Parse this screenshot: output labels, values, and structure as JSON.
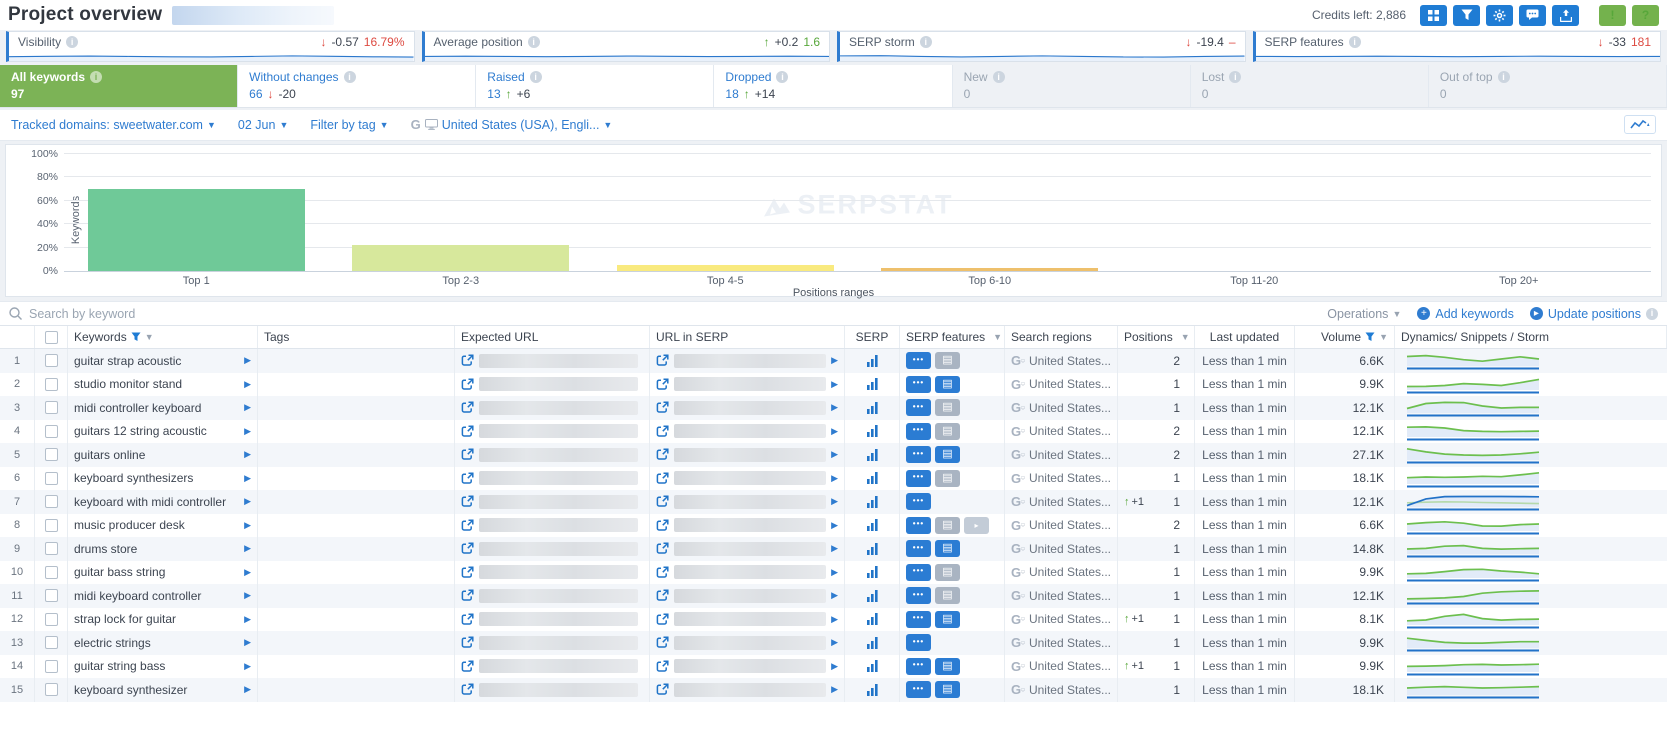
{
  "topbar": {
    "title": "Project overview",
    "credits": "Credits left: 2,886"
  },
  "accent_colors": {
    "blue": "#2f7cd0",
    "green_tab": "#7cb356",
    "red": "#dd4a41",
    "green": "#57a73a"
  },
  "metric_cards": [
    {
      "label": "Visibility",
      "arrow": "↓",
      "arrow_color": "red",
      "delta": "-0.57",
      "value": "16.79%",
      "value_color": "red",
      "wave": [
        0.45,
        0.52,
        0.55,
        0.5,
        0.44,
        0.42,
        0.5,
        0.58,
        0.52,
        0.44,
        0.4
      ]
    },
    {
      "label": "Average position",
      "arrow": "↑",
      "arrow_color": "green",
      "delta": "+0.2",
      "value": "1.6",
      "value_color": "green",
      "wave": [
        0.5,
        0.53,
        0.5,
        0.46,
        0.5,
        0.55,
        0.52,
        0.47,
        0.5,
        0.53,
        0.5
      ]
    },
    {
      "label": "SERP storm",
      "arrow": "↓",
      "arrow_color": "red",
      "delta": "-19.4",
      "value": "–",
      "value_color": "red",
      "wave": [
        0.58,
        0.62,
        0.5,
        0.42,
        0.5,
        0.58,
        0.5,
        0.42,
        0.4,
        0.5,
        0.55
      ]
    },
    {
      "label": "SERP features",
      "arrow": "↓",
      "arrow_color": "red",
      "delta": "-33",
      "value": "181",
      "value_color": "red",
      "wave": [
        0.5,
        0.47,
        0.5,
        0.54,
        0.5,
        0.46,
        0.5,
        0.54,
        0.5,
        0.47,
        0.5
      ]
    }
  ],
  "tabs": [
    {
      "label": "All keywords",
      "value": "97",
      "state": "active",
      "arrow": "",
      "delta": ""
    },
    {
      "label": "Without changes",
      "value": "66",
      "state": "normal",
      "arrow": "↓",
      "arrow_color": "red",
      "delta": "-20"
    },
    {
      "label": "Raised",
      "value": "13",
      "state": "normal",
      "arrow": "↑",
      "arrow_color": "green",
      "delta": "+6"
    },
    {
      "label": "Dropped",
      "value": "18",
      "state": "normal",
      "arrow": "↑",
      "arrow_color": "green",
      "delta": "+14"
    },
    {
      "label": "New",
      "value": "0",
      "state": "disabled",
      "arrow": "",
      "delta": ""
    },
    {
      "label": "Lost",
      "value": "0",
      "state": "disabled",
      "arrow": "",
      "delta": ""
    },
    {
      "label": "Out of top",
      "value": "0",
      "state": "disabled",
      "arrow": "",
      "delta": ""
    }
  ],
  "filter_bar": {
    "tracked_domains": "Tracked domains: sweetwater.com",
    "date": "02 Jun",
    "tag": "Filter by tag",
    "region": "United States (USA), Engli..."
  },
  "chart_data": {
    "type": "bar",
    "categories": [
      "Top 1",
      "Top 2-3",
      "Top 4-5",
      "Top 6-10",
      "Top 11-20",
      "Top 20+"
    ],
    "values": [
      70,
      22,
      5,
      3,
      0,
      0
    ],
    "unit": "%",
    "bar_colors": [
      "#6fc998",
      "#d7e89c",
      "#f9ea7f",
      "#eec06c",
      "#cfd6df",
      "#cfd6df"
    ],
    "title": "",
    "xlabel": "Positions ranges",
    "ylabel": "Keywords",
    "ylim": [
      0,
      100
    ],
    "yticks": [
      "0%",
      "20%",
      "40%",
      "60%",
      "80%",
      "100%"
    ],
    "grid": true,
    "legend": "none",
    "watermark": "SERPSTAT"
  },
  "actions": {
    "search_placeholder": "Search by keyword",
    "operations": "Operations",
    "add_keywords": "Add keywords",
    "update_positions": "Update positions"
  },
  "table": {
    "columns": [
      "#",
      "Keywords",
      "Tags",
      "Expected URL",
      "URL in SERP",
      "SERP",
      "SERP features",
      "Search regions",
      "Positions",
      "Last updated",
      "Volume",
      "Dynamics/ Snippets / Storm"
    ],
    "filtered_columns": [
      "Keywords",
      "SERP features",
      "Positions",
      "Volume"
    ],
    "region_text": "United States...",
    "updated_text": "Less than 1 min",
    "rows": [
      {
        "num": "1",
        "keyword": "guitar strap acoustic",
        "features": [
          "dots-blue",
          "snippet-grey"
        ],
        "pos_delta": "",
        "position": "2",
        "volume": "6.6K",
        "spark": {
          "variant": "green",
          "line": [
            0.68,
            0.74,
            0.62,
            0.45,
            0.34,
            0.5,
            0.66,
            0.5
          ]
        }
      },
      {
        "num": "2",
        "keyword": "studio monitor stand",
        "features": [
          "dots-blue",
          "snippet-blue"
        ],
        "pos_delta": "",
        "position": "1",
        "volume": "9.9K",
        "spark": {
          "variant": "green",
          "line": [
            0.25,
            0.26,
            0.32,
            0.46,
            0.4,
            0.32,
            0.52,
            0.76
          ]
        }
      },
      {
        "num": "3",
        "keyword": "midi controller keyboard",
        "features": [
          "dots-blue",
          "snippet-grey"
        ],
        "pos_delta": "",
        "position": "1",
        "volume": "12.1K",
        "spark": {
          "variant": "green",
          "line": [
            0.32,
            0.68,
            0.76,
            0.74,
            0.5,
            0.36,
            0.4,
            0.4
          ]
        }
      },
      {
        "num": "4",
        "keyword": "guitars 12 string acoustic",
        "features": [
          "dots-blue",
          "snippet-grey"
        ],
        "pos_delta": "",
        "position": "2",
        "volume": "12.1K",
        "spark": {
          "variant": "green",
          "line": [
            0.7,
            0.72,
            0.64,
            0.46,
            0.4,
            0.38,
            0.4,
            0.42
          ]
        }
      },
      {
        "num": "5",
        "keyword": "guitars online",
        "features": [
          "dots-blue",
          "snippet-blue"
        ],
        "pos_delta": "",
        "position": "2",
        "volume": "27.1K",
        "spark": {
          "variant": "green",
          "line": [
            0.8,
            0.58,
            0.42,
            0.36,
            0.33,
            0.36,
            0.44,
            0.56
          ]
        }
      },
      {
        "num": "6",
        "keyword": "keyboard synthesizers",
        "features": [
          "dots-blue",
          "snippet-grey"
        ],
        "pos_delta": "",
        "position": "1",
        "volume": "18.1K",
        "spark": {
          "variant": "green",
          "line": [
            0.45,
            0.5,
            0.48,
            0.5,
            0.55,
            0.52,
            0.65,
            0.8
          ]
        }
      },
      {
        "num": "7",
        "keyword": "keyboard with midi controller",
        "features": [
          "dots-blue"
        ],
        "pos_delta": "+1",
        "position": "1",
        "volume": "12.1K",
        "spark": {
          "variant": "blue",
          "line": [
            0.1,
            0.58,
            0.74,
            0.75,
            0.75,
            0.75,
            0.74,
            0.73
          ],
          "line2": [
            0.3,
            0.34,
            0.37,
            0.36,
            0.32,
            0.3,
            0.27,
            0.24
          ]
        }
      },
      {
        "num": "8",
        "keyword": "music producer desk",
        "features": [
          "dots-blue",
          "snippet-grey",
          "arrow-grey"
        ],
        "pos_delta": "",
        "position": "2",
        "volume": "6.6K",
        "spark": {
          "variant": "green",
          "line": [
            0.5,
            0.6,
            0.66,
            0.56,
            0.36,
            0.35,
            0.46,
            0.5
          ]
        }
      },
      {
        "num": "9",
        "keyword": "drums store",
        "features": [
          "dots-blue",
          "snippet-blue"
        ],
        "pos_delta": "",
        "position": "1",
        "volume": "14.8K",
        "spark": {
          "variant": "green",
          "line": [
            0.36,
            0.4,
            0.56,
            0.6,
            0.4,
            0.35,
            0.38,
            0.4
          ]
        }
      },
      {
        "num": "10",
        "keyword": "guitar bass string",
        "features": [
          "dots-blue",
          "snippet-grey"
        ],
        "pos_delta": "",
        "position": "1",
        "volume": "9.9K",
        "spark": {
          "variant": "green",
          "line": [
            0.3,
            0.33,
            0.46,
            0.6,
            0.62,
            0.5,
            0.42,
            0.3
          ]
        }
      },
      {
        "num": "11",
        "keyword": "midi keyboard controller",
        "features": [
          "dots-blue",
          "snippet-grey"
        ],
        "pos_delta": "",
        "position": "1",
        "volume": "12.1K",
        "spark": {
          "variant": "green",
          "line": [
            0.15,
            0.18,
            0.22,
            0.32,
            0.56,
            0.66,
            0.7,
            0.72
          ]
        }
      },
      {
        "num": "12",
        "keyword": "strap lock for guitar",
        "features": [
          "dots-blue",
          "snippet-blue"
        ],
        "pos_delta": "+1",
        "position": "1",
        "volume": "8.1K",
        "spark": {
          "variant": "green",
          "line": [
            0.3,
            0.36,
            0.62,
            0.76,
            0.46,
            0.35,
            0.4,
            0.42
          ]
        }
      },
      {
        "num": "13",
        "keyword": "electric strings",
        "features": [
          "dots-blue"
        ],
        "pos_delta": "",
        "position": "1",
        "volume": "9.9K",
        "spark": {
          "variant": "green",
          "line": [
            0.7,
            0.54,
            0.4,
            0.35,
            0.35,
            0.4,
            0.45,
            0.45
          ]
        }
      },
      {
        "num": "14",
        "keyword": "guitar string bass",
        "features": [
          "dots-blue",
          "snippet-blue"
        ],
        "pos_delta": "+1",
        "position": "1",
        "volume": "9.9K",
        "spark": {
          "variant": "green",
          "line": [
            0.4,
            0.42,
            0.46,
            0.52,
            0.54,
            0.5,
            0.52,
            0.56
          ]
        }
      },
      {
        "num": "15",
        "keyword": "keyboard synthesizer",
        "features": [
          "dots-blue",
          "snippet-blue"
        ],
        "pos_delta": "",
        "position": "1",
        "volume": "18.1K",
        "spark": {
          "variant": "green",
          "line": [
            0.5,
            0.56,
            0.6,
            0.55,
            0.5,
            0.52,
            0.56,
            0.6
          ]
        }
      }
    ]
  }
}
